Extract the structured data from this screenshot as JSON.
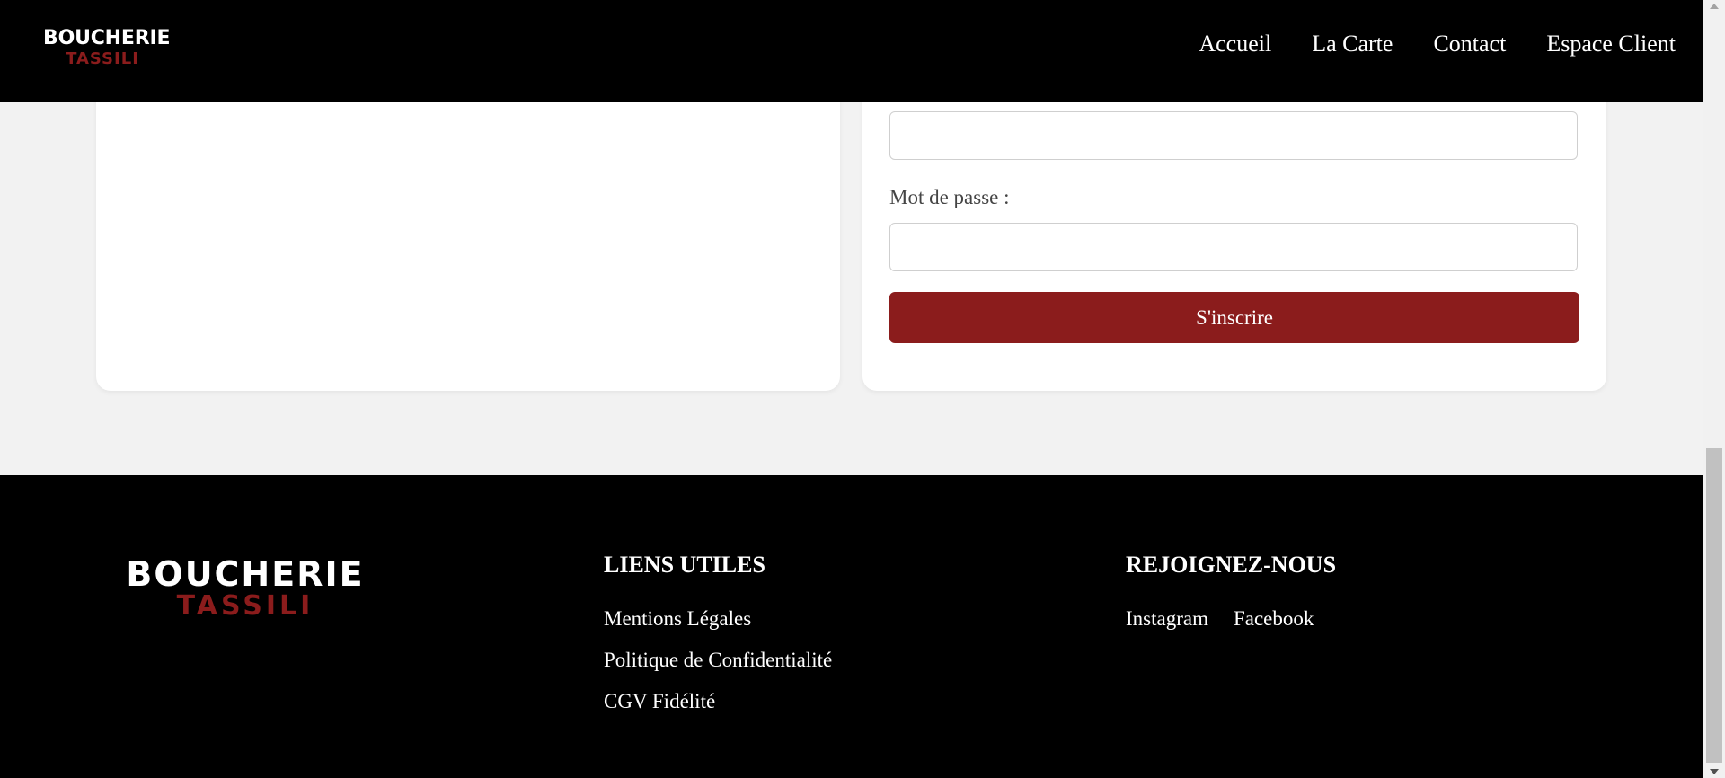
{
  "header": {
    "logo": {
      "line1": "BOUCHERIE",
      "line2": "TASSILI"
    },
    "nav": [
      "Accueil",
      "La Carte",
      "Contact",
      "Espace Client"
    ]
  },
  "signup_form": {
    "password_label": "Mot de passe :",
    "submit_label": "S'inscrire"
  },
  "footer": {
    "logo": {
      "line1": "BOUCHERIE",
      "line2": "TASSILI"
    },
    "links_title": "LIENS UTILES",
    "links": [
      "Mentions Légales",
      "Politique de Confidentialité",
      "CGV Fidélité"
    ],
    "social_title": "REJOIGNEZ-NOUS",
    "social": [
      "Instagram",
      "Facebook"
    ]
  },
  "colors": {
    "brand_red": "#8b1c1c",
    "header_bg": "#000000",
    "page_bg": "#f2f2f2"
  }
}
